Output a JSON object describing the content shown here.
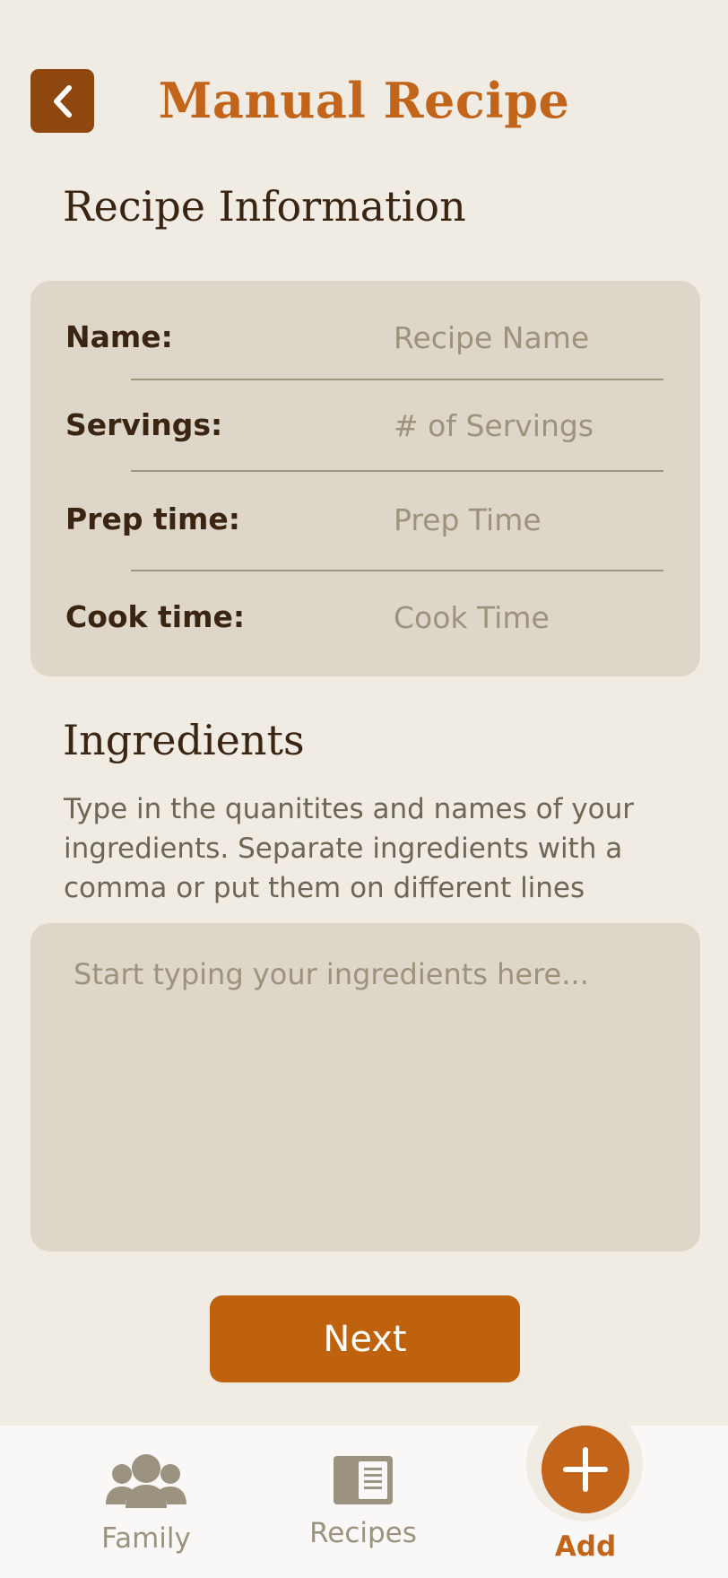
{
  "header": {
    "title": "Manual Recipe",
    "back_icon": "chevron-left-icon"
  },
  "recipe_info": {
    "heading": "Recipe Information",
    "fields": [
      {
        "label": "Name:",
        "placeholder": "Recipe Name",
        "value": ""
      },
      {
        "label": "Servings:",
        "placeholder": "# of Servings",
        "value": ""
      },
      {
        "label": "Prep time:",
        "placeholder": "Prep Time",
        "value": ""
      },
      {
        "label": "Cook time:",
        "placeholder": "Cook Time",
        "value": ""
      }
    ]
  },
  "ingredients": {
    "heading": "Ingredients",
    "description": "Type in the quanitites and names of your ingredients. Separate ingredients with a comma or put them on different lines",
    "placeholder": "Start typing your ingredients here...",
    "value": ""
  },
  "next_label": "Next",
  "tab_bar": {
    "items": [
      {
        "label": "Family",
        "icon": "family-icon"
      },
      {
        "label": "Recipes",
        "icon": "recipe-book-icon"
      },
      {
        "label": "Add",
        "icon": "plus-icon"
      }
    ]
  },
  "colors": {
    "background": "#f0ebe3",
    "accent": "#c2651a",
    "back_button": "#8f4710",
    "card": "#ded6c9",
    "text_dark": "#3a2412",
    "muted": "#9c9280"
  }
}
